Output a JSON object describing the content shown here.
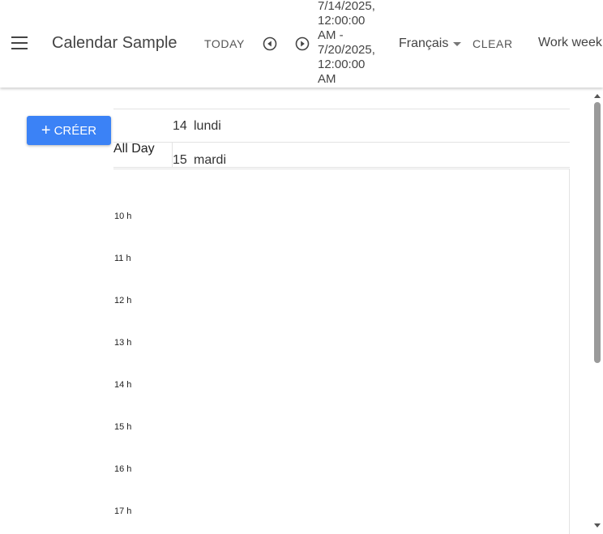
{
  "header": {
    "menu_icon": "hamburger-menu-icon",
    "title": "Calendar Sample",
    "today_label": "TODAY",
    "prev_icon": "arrow-left-circle-icon",
    "next_icon": "arrow-right-circle-icon",
    "date_range_lines": [
      "7/14/2025,",
      "12:00:00",
      "AM -",
      "7/20/2025,",
      "12:00:00",
      "AM"
    ],
    "language": "Français",
    "clear_label": "CLEAR",
    "view_label": "Work week"
  },
  "sidebar": {
    "create_label": "CRÉER",
    "create_icon": "plus-icon",
    "accent_color": "#3b82f6"
  },
  "calendar": {
    "all_day_label": "All Day",
    "days": [
      {
        "num": "14",
        "name": "lundi"
      },
      {
        "num": "15",
        "name": "mardi"
      }
    ],
    "hours": [
      "10 h",
      "11 h",
      "12 h",
      "13 h",
      "14 h",
      "15 h",
      "16 h",
      "17 h"
    ]
  }
}
